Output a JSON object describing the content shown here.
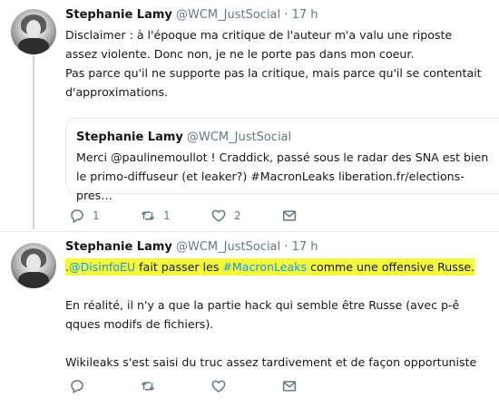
{
  "tweets": [
    {
      "author_name": "Stephanie Lamy",
      "handle": "@WCM_JustSocial",
      "separator": "·",
      "time": "17 h",
      "lines": [
        "Disclaimer : à l'époque ma critique de l'auteur m'a valu une riposte assez violente. Donc non, je ne le porte pas dans mon coeur.",
        "Pas parce qu'il ne supporte pas la critique, mais parce qu'il se contentait d'approximations."
      ],
      "quote": {
        "author_name": "Stephanie Lamy",
        "handle": "@WCM_JustSocial",
        "text_pre": "Merci @paulinemoullot ! Craddick, passé sous le radar des SNA est bien le primo-diffuseur (et leaker?) ",
        "hashtag": "#MacronLeaks",
        "text_post": " liberation.fr/elections-pres…"
      },
      "actions": {
        "reply_count": "1",
        "retweet_count": "1",
        "like_count": "2"
      }
    },
    {
      "author_name": "Stephanie Lamy",
      "handle": "@WCM_JustSocial",
      "separator": "·",
      "time": "17 h",
      "line1": {
        "prefix": ".",
        "mention": "@DisinfoEU",
        "middle": " fait passer les ",
        "hashtag": "#MacronLeaks",
        "suffix": " comme une offensive Russe."
      },
      "line2": "En réalité, il n'y a que la partie hack qui semble être Russe (avec p-ê qques modifs de fichiers).",
      "line3": "Wikileaks s'est saisi du truc assez tardivement et de façon opportuniste",
      "actions": {
        "reply_count": "",
        "retweet_count": "",
        "like_count": ""
      }
    }
  ],
  "colors": {
    "accent": "#1b95e0",
    "muted": "#657786",
    "highlight": "#f4fb3a",
    "border": "#e1e8ed"
  },
  "icons": [
    "reply-icon",
    "retweet-icon",
    "like-icon",
    "share-icon"
  ]
}
